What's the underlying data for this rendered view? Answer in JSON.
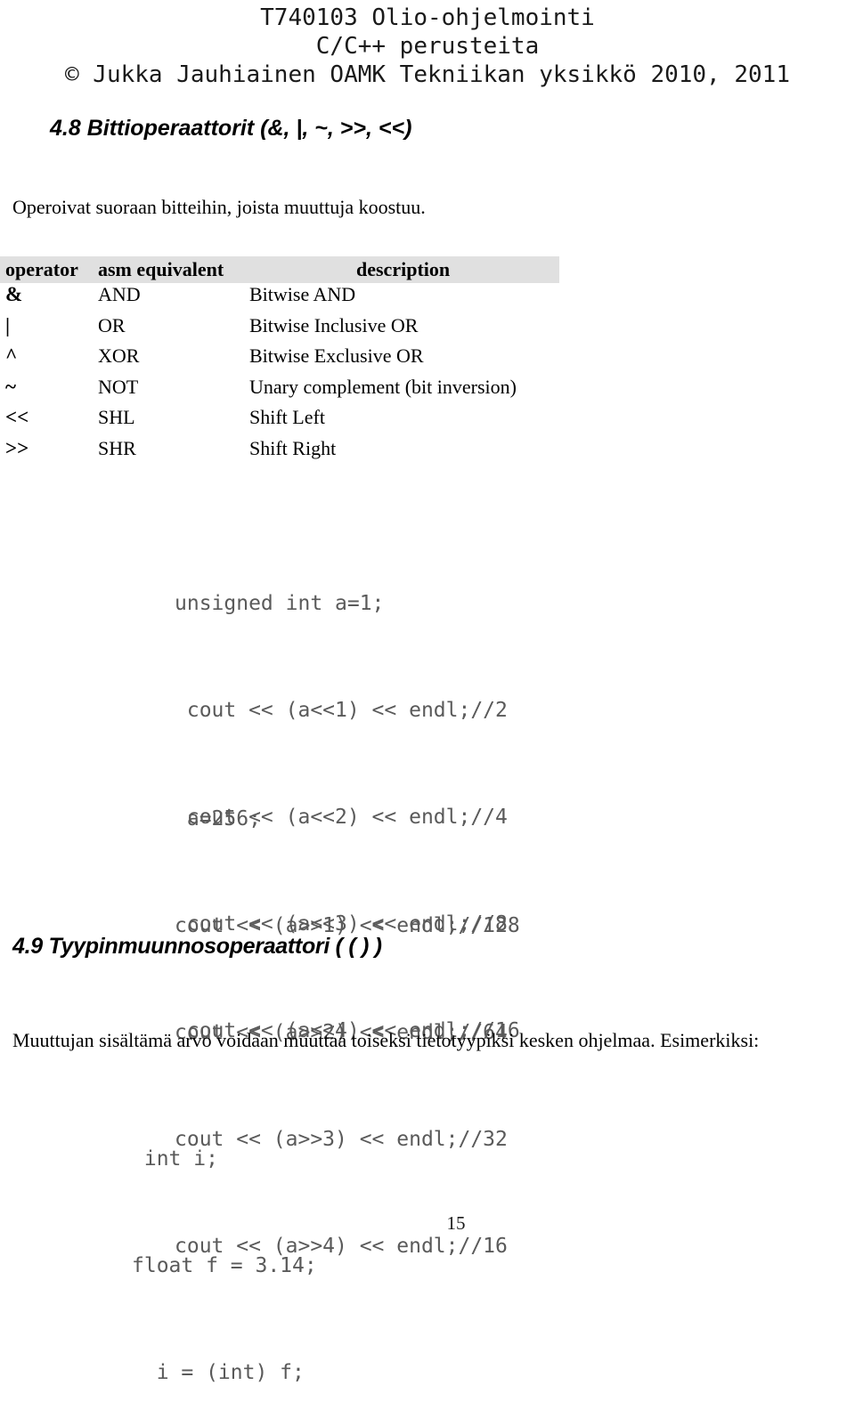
{
  "header": {
    "line1": "T740103 Olio-ohjelmointi",
    "line2": "C/C++ perusteita",
    "line3": "© Jukka Jauhiainen OAMK Tekniikan yksikkö 2010, 2011"
  },
  "sections": {
    "bitwise": {
      "heading": "4.8 Bittioperaattorit (&, |, ~, >>, <<)",
      "intro": "Operoivat suoraan bitteihin, joista muuttuja koostuu."
    },
    "cast": {
      "heading": "4.9 Tyypinmuunnosoperaattori ( ( ) )",
      "intro": "Muuttujan sisältämä arvo voidaan muuttaa toiseksi tietotyypiksi kesken ohjelmaa. Esimerkiksi:"
    }
  },
  "operator_table": {
    "headers": [
      "operator",
      "asm equivalent",
      "description"
    ],
    "rows": [
      {
        "operator": "&",
        "asm": "AND",
        "description": "Bitwise AND"
      },
      {
        "operator": "|",
        "asm": "OR",
        "description": "Bitwise Inclusive OR"
      },
      {
        "operator": "^",
        "asm": "XOR",
        "description": "Bitwise Exclusive OR"
      },
      {
        "operator": "~",
        "asm": "NOT",
        "description": "Unary complement (bit inversion)"
      },
      {
        "operator": "<<",
        "asm": "SHL",
        "description": "Shift Left"
      },
      {
        "operator": ">>",
        "asm": "SHR",
        "description": "Shift Right"
      }
    ],
    "header_background": "#e0e0e0"
  },
  "code_blocks": {
    "shift_left": [
      "unsigned int a=1;",
      " cout << (a<<1) << endl;//2",
      " cout << (a<<2) << endl;//4",
      " cout << (a<<3) << endl;//8",
      " cout << (a<<4) << endl;//16"
    ],
    "shift_right": [
      " a=256;",
      "cout << (a>>1) << endl;//128",
      "cout << (a>>2) << endl;//64",
      "cout << (a>>3) << endl;//32",
      "cout << (a>>4) << endl;//16"
    ],
    "cast_example": [
      " int i;",
      "float f = 3.14;",
      "  i = (int) f;"
    ],
    "text_color": "#5a5a5a"
  },
  "footer": {
    "page_number": "15"
  }
}
